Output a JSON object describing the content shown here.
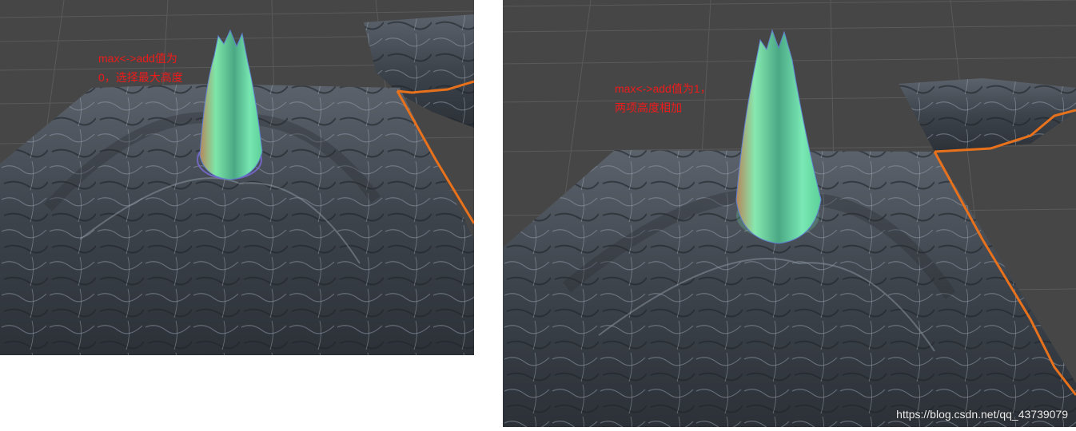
{
  "left_view": {
    "annotation": {
      "line1": "max<->add值为",
      "line2": "0，选择最大高度"
    },
    "terrain_texture": "rocky-grey",
    "spike_color": "#6ee0a6",
    "boundary_color": "#e8711c"
  },
  "right_view": {
    "annotation": {
      "line1": "max<->add值为1，",
      "line2": "两项高度相加"
    },
    "terrain_texture": "rocky-grey",
    "spike_color": "#6ee0a6",
    "boundary_color": "#e8711c"
  },
  "watermark": "https://blog.csdn.net/qq_43739079",
  "colors": {
    "viewport_bg": "#464646",
    "grid_line": "#5c5c5c",
    "annotation_text": "#ee1b1b"
  }
}
